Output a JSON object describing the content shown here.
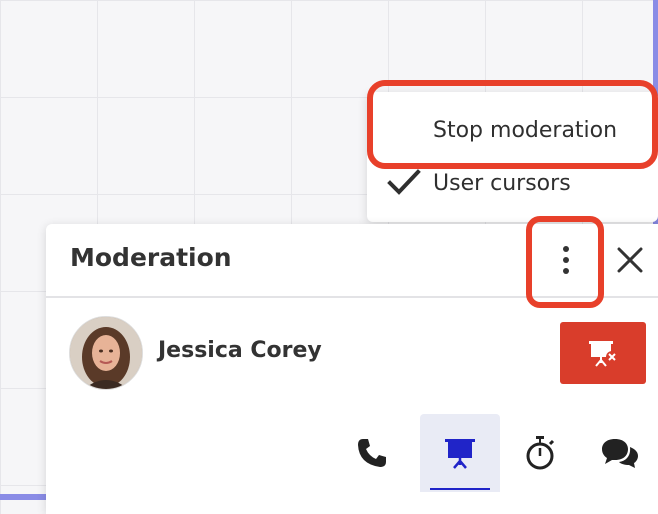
{
  "menu": {
    "items": [
      {
        "label": "Stop moderation",
        "checked": false
      },
      {
        "label": "User cursors",
        "checked": true
      }
    ]
  },
  "panel": {
    "title": "Moderation",
    "more_icon": "vertical-ellipsis-icon",
    "close_icon": "close-icon"
  },
  "user": {
    "name": "Jessica Corey",
    "action_icon": "stop-presentation-icon"
  },
  "toolbar": {
    "buttons": [
      {
        "icon": "phone-icon",
        "active": false
      },
      {
        "icon": "presentation-icon",
        "active": true
      },
      {
        "icon": "stopwatch-icon",
        "active": false
      },
      {
        "icon": "chat-icon",
        "active": false
      }
    ]
  },
  "colors": {
    "accent": "#2024c8",
    "danger": "#d93d2b",
    "highlight": "#e8402a",
    "canvas_edge": "#8a8ce6"
  }
}
